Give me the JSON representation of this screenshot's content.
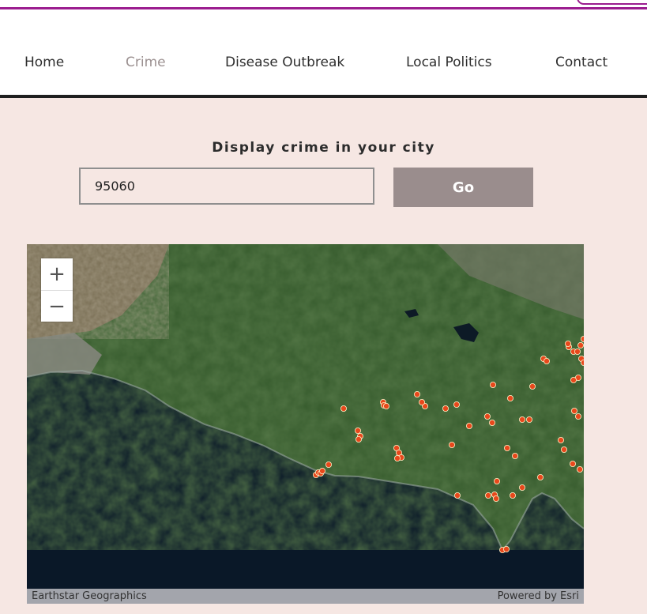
{
  "nav": {
    "items": [
      {
        "label": "Home",
        "active": false
      },
      {
        "label": "Crime",
        "active": true
      },
      {
        "label": "Disease Outbreak",
        "active": false
      },
      {
        "label": "Local Politics",
        "active": false
      },
      {
        "label": "Contact",
        "active": false
      }
    ]
  },
  "search": {
    "title": "Display crime in your city",
    "zip_value": "95060",
    "go_label": "Go"
  },
  "map": {
    "basemap": "satellite imagery",
    "zoom_in_icon": "plus-icon",
    "zoom_out_icon": "minus-icon",
    "attribution_left": "Earthstar Geographics",
    "attribution_right": "Powered by Esri",
    "marker_color": "#e8481c",
    "crime_marker_count": 60
  },
  "colors": {
    "accent": "#9b1d8f",
    "page_bg": "#f6e7e3",
    "go_button": "#9a8d8d"
  }
}
